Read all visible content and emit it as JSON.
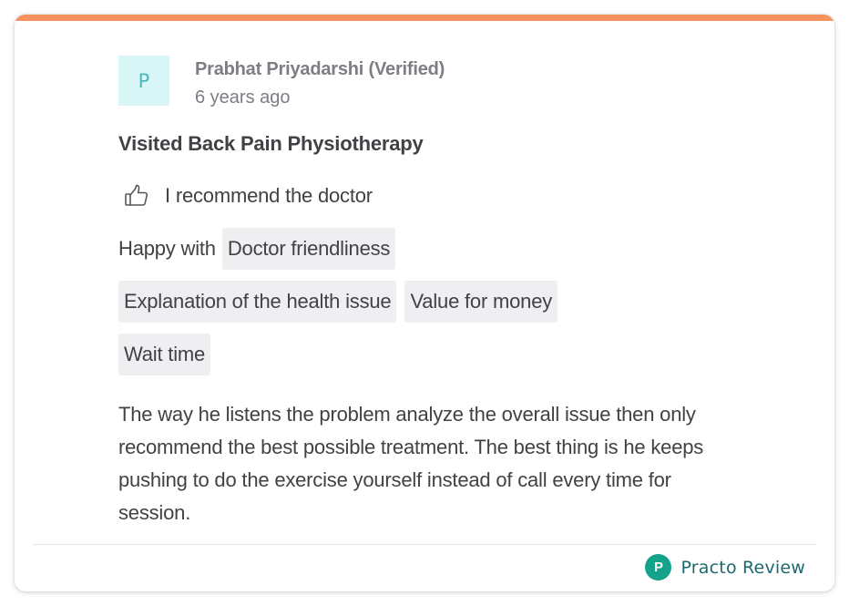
{
  "colors": {
    "accent_bar": "#f6925e",
    "avatar_bg": "#d9f6f7",
    "avatar_text": "#48b9bd",
    "chip_bg": "#efeff2",
    "practo_green": "#14a28a"
  },
  "reviewer": {
    "initial": "P",
    "name": "Prabhat Priyadarshi (Verified)",
    "time_ago": "6 years ago"
  },
  "visit": {
    "title": "Visited Back Pain Physiotherapy"
  },
  "recommendation": {
    "icon": "thumbs-up-icon",
    "text": "I recommend the doctor"
  },
  "happy_with": {
    "label": "Happy with",
    "chips": [
      "Doctor friendliness",
      "Explanation of the health issue",
      "Value for money",
      "Wait time"
    ]
  },
  "review": {
    "text": "The way he listens the problem analyze the overall issue then only recommend the best possible treatment. The best thing is he keeps pushing to do the exercise yourself instead of call every time for session."
  },
  "footer": {
    "logo_letter": "P",
    "source_label": "Practo Review"
  }
}
